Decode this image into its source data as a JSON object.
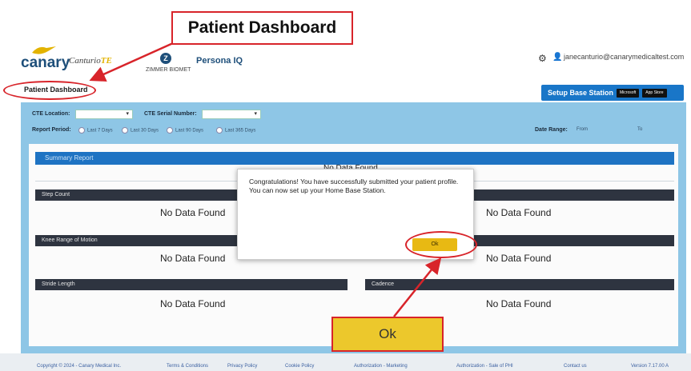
{
  "callouts": {
    "title": "Patient Dashboard",
    "ok_label": "Ok"
  },
  "header": {
    "brand": "canary",
    "product": "Canturio",
    "product_suffix": "TE",
    "partner": "ZIMMER BIOMET",
    "partner_mark": "Z",
    "app": "Persona",
    "app_suffix": "IQ",
    "user_email": "janecanturio@canarymedicaltest.com"
  },
  "nav": {
    "tab": "Patient Dashboard"
  },
  "setup": {
    "label": "Setup Base Station",
    "badge_ms": "Microsoft",
    "badge_apple": "App Store"
  },
  "filters": {
    "location_label": "CTE Location:",
    "serial_label": "CTE Serial Number:",
    "period_label": "Report Period:",
    "periods": [
      "Last 7 Days",
      "Last 30 Days",
      "Last 90 Days",
      "Last 365 Days"
    ],
    "date_range_label": "Date Range:",
    "from": "From",
    "to": "To"
  },
  "summary": {
    "title": "Summary Report",
    "value": "No Data Found"
  },
  "cards": [
    {
      "title": "Step Count",
      "value": "No Data Found"
    },
    {
      "title": "",
      "value": "No Data Found"
    },
    {
      "title": "Knee Range of Motion",
      "value": "No Data Found"
    },
    {
      "title": "",
      "value": "No Data Found"
    },
    {
      "title": "Stride Length",
      "value": "No Data Found"
    },
    {
      "title": "Cadence",
      "value": "No Data Found"
    }
  ],
  "modal": {
    "message": "Congratulations! You have successfully submitted your patient profile. You can now set up your Home Base Station.",
    "ok": "Ok"
  },
  "footer": {
    "links": [
      "Copyright © 2024 - Canary Medical Inc.",
      "Terms & Conditions",
      "Privacy Policy",
      "Cookie Policy",
      "Authorization - Marketing",
      "Authorization - Sale of PHI",
      "Contact us",
      "Version 7.17.00 A"
    ]
  },
  "colors": {
    "accent_red": "#d8242a",
    "brand_blue": "#1976c8",
    "panel_blue": "#8ec6e6",
    "ok_yellow": "#e8b913"
  }
}
